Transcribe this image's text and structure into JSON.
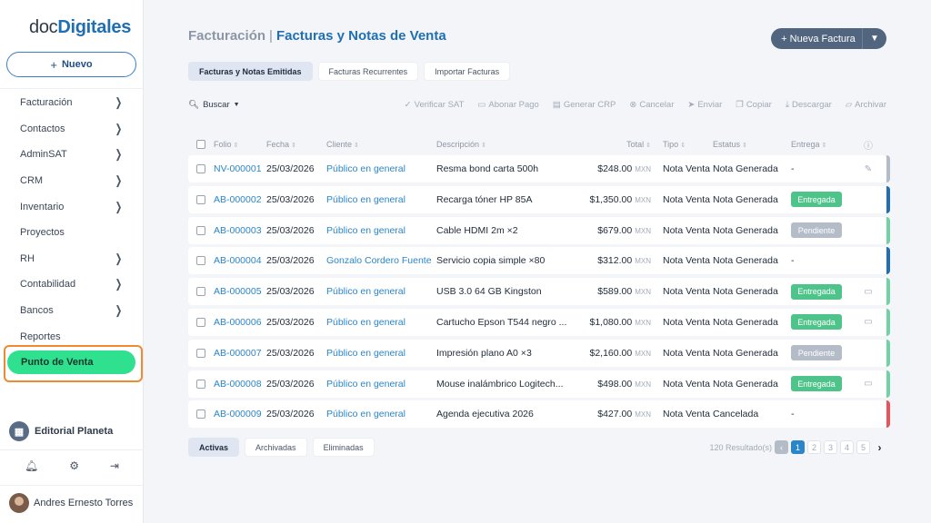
{
  "logo": {
    "part1": "doc",
    "part2": "Digitales"
  },
  "sidebar": {
    "new_button": "Nuevo",
    "items": [
      {
        "label": "Facturación",
        "chevron": true
      },
      {
        "label": "Contactos",
        "chevron": true
      },
      {
        "label": "AdminSAT",
        "chevron": true
      },
      {
        "label": "CRM",
        "chevron": true
      },
      {
        "label": "Inventario",
        "chevron": true
      },
      {
        "label": "Proyectos",
        "chevron": false
      },
      {
        "label": "RH",
        "chevron": true
      },
      {
        "label": "Contabilidad",
        "chevron": true
      },
      {
        "label": "Bancos",
        "chevron": true
      },
      {
        "label": "Reportes",
        "chevron": false
      }
    ],
    "active_item": "Punto de Venta",
    "company": "Editorial Planeta",
    "user": "Andres Ernesto Torres"
  },
  "header": {
    "section": "Facturación",
    "separator": "|",
    "page": "Facturas y Notas de Venta",
    "new_invoice": "Nueva Factura"
  },
  "tabs": [
    "Facturas y Notas Emitidas",
    "Facturas Recurrentes",
    "Importar Facturas"
  ],
  "toolbar": {
    "search": "Buscar",
    "actions": [
      "Verificar SAT",
      "Abonar Pago",
      "Generar CRP",
      "Cancelar",
      "Enviar",
      "Copiar",
      "Descargar",
      "Archivar"
    ]
  },
  "columns": [
    "Folio",
    "Fecha",
    "Cliente",
    "Descripción",
    "Total",
    "Tipo",
    "Estatus",
    "Entrega"
  ],
  "rows": [
    {
      "folio": "NV-000001",
      "fecha": "25/03/2026",
      "cliente": "Público en general",
      "desc": "Resma bond carta 500h",
      "total": "$248.00",
      "cur": "MXN",
      "tipo": "Nota Venta",
      "estatus": "Nota Generada",
      "entrega": "-",
      "badge": "",
      "icon": "pencil",
      "edge": "#b4bcc8"
    },
    {
      "folio": "AB-000002",
      "fecha": "25/03/2026",
      "cliente": "Público en general",
      "desc": "Recarga tóner HP 85A",
      "total": "$1,350.00",
      "cur": "MXN",
      "tipo": "Nota Venta",
      "estatus": "Nota Generada",
      "entrega": "Entregada",
      "badge": "green",
      "icon": "",
      "edge": "#1f6fb2"
    },
    {
      "folio": "AB-000003",
      "fecha": "25/03/2026",
      "cliente": "Público en general",
      "desc": "Cable HDMI 2m ×2",
      "total": "$679.00",
      "cur": "MXN",
      "tipo": "Nota Venta",
      "estatus": "Nota Generada",
      "entrega": "Pendiente",
      "badge": "gray",
      "icon": "",
      "edge": "#6fd3a6"
    },
    {
      "folio": "AB-000004",
      "fecha": "25/03/2026",
      "cliente": "Gonzalo Cordero Fuente",
      "desc": "Servicio copia simple ×80",
      "total": "$312.00",
      "cur": "MXN",
      "tipo": "Nota Venta",
      "estatus": "Nota Generada",
      "entrega": "-",
      "badge": "",
      "icon": "",
      "edge": "#1f6fb2"
    },
    {
      "folio": "AB-000005",
      "fecha": "25/03/2026",
      "cliente": "Público en general",
      "desc": "USB 3.0 64 GB Kingston",
      "total": "$589.00",
      "cur": "MXN",
      "tipo": "Nota Venta",
      "estatus": "Nota Generada",
      "entrega": "Entregada",
      "badge": "green",
      "icon": "card",
      "edge": "#6fd3a6"
    },
    {
      "folio": "AB-000006",
      "fecha": "25/03/2026",
      "cliente": "Público en general",
      "desc": "Cartucho Epson T544 negro ...",
      "total": "$1,080.00",
      "cur": "MXN",
      "tipo": "Nota Venta",
      "estatus": "Nota Generada",
      "entrega": "Entregada",
      "badge": "green",
      "icon": "card",
      "edge": "#6fd3a6"
    },
    {
      "folio": "AB-000007",
      "fecha": "25/03/2026",
      "cliente": "Público en general",
      "desc": "Impresión plano A0 ×3",
      "total": "$2,160.00",
      "cur": "MXN",
      "tipo": "Nota Venta",
      "estatus": "Nota Generada",
      "entrega": "Pendiente",
      "badge": "gray",
      "icon": "",
      "edge": "#6fd3a6"
    },
    {
      "folio": "AB-000008",
      "fecha": "25/03/2026",
      "cliente": "Público en general",
      "desc": "Mouse inalámbrico Logitech...",
      "total": "$498.00",
      "cur": "MXN",
      "tipo": "Nota Venta",
      "estatus": "Nota Generada",
      "entrega": "Entregada",
      "badge": "green",
      "icon": "card",
      "edge": "#6fd3a6"
    },
    {
      "folio": "AB-000009",
      "fecha": "25/03/2026",
      "cliente": "Público en general",
      "desc": "Agenda ejecutiva 2026",
      "total": "$427.00",
      "cur": "MXN",
      "tipo": "Nota Venta",
      "estatus": "Cancelada",
      "entrega": "-",
      "badge": "",
      "icon": "",
      "edge": "#e8545a"
    }
  ],
  "footer": {
    "tabs": [
      "Activas",
      "Archivadas",
      "Eliminadas"
    ],
    "results": "120 Resultado(s)",
    "pages": [
      "1",
      "2",
      "3",
      "4",
      "5"
    ],
    "current_page": "1"
  }
}
